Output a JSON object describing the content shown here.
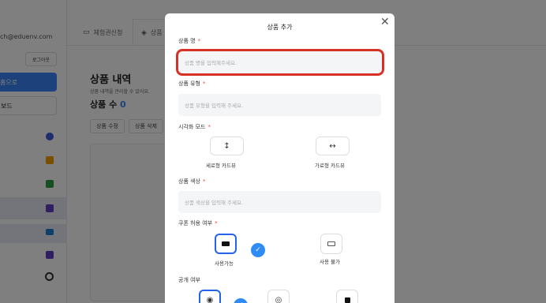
{
  "sidebar": {
    "email": "ch@eduenv.com",
    "logout_label": "로그아웃",
    "home_label": "홈으로",
    "dashboard_label": "보드"
  },
  "tabs": [
    {
      "label": "체험권신청",
      "icon": "calendar-icon"
    },
    {
      "label": "상품",
      "icon": "box-icon"
    }
  ],
  "page": {
    "title": "상품 내역",
    "subtitle": "상품 내역을 관리할 수 있어요.",
    "count_label": "상품 수",
    "count_value": "0",
    "edit_label": "상품 수정",
    "delete_label": "상품 삭제"
  },
  "modal": {
    "title": "상품 추가",
    "name_label": "상품 명",
    "name_placeholder": "상품 명을 입력해주세요.",
    "type_label": "상품 유형",
    "type_placeholder": "상품 유형을 입력해 주세요.",
    "view_label": "시각화 모드",
    "view_options": [
      {
        "label": "세로형 카드뷰",
        "icon": "vertical-arrow-icon",
        "glyph": "↕"
      },
      {
        "label": "가로형 카드뷰",
        "icon": "horizontal-arrow-icon",
        "glyph": "↔"
      }
    ],
    "color_label": "상품 색상",
    "color_placeholder": "상품 색상을 입력해 주세요.",
    "coupon_label": "쿠폰 허용 여부",
    "coupon_options": [
      {
        "label": "사용가능",
        "icon": "ticket-icon",
        "selected": true
      },
      {
        "label": "사용 불가",
        "icon": "ticket-outline-icon",
        "selected": false
      }
    ],
    "public_label": "공개 여부"
  },
  "colors": {
    "accent": "#2f8bf5",
    "required": "#ef4444",
    "highlight": "#d93025"
  }
}
